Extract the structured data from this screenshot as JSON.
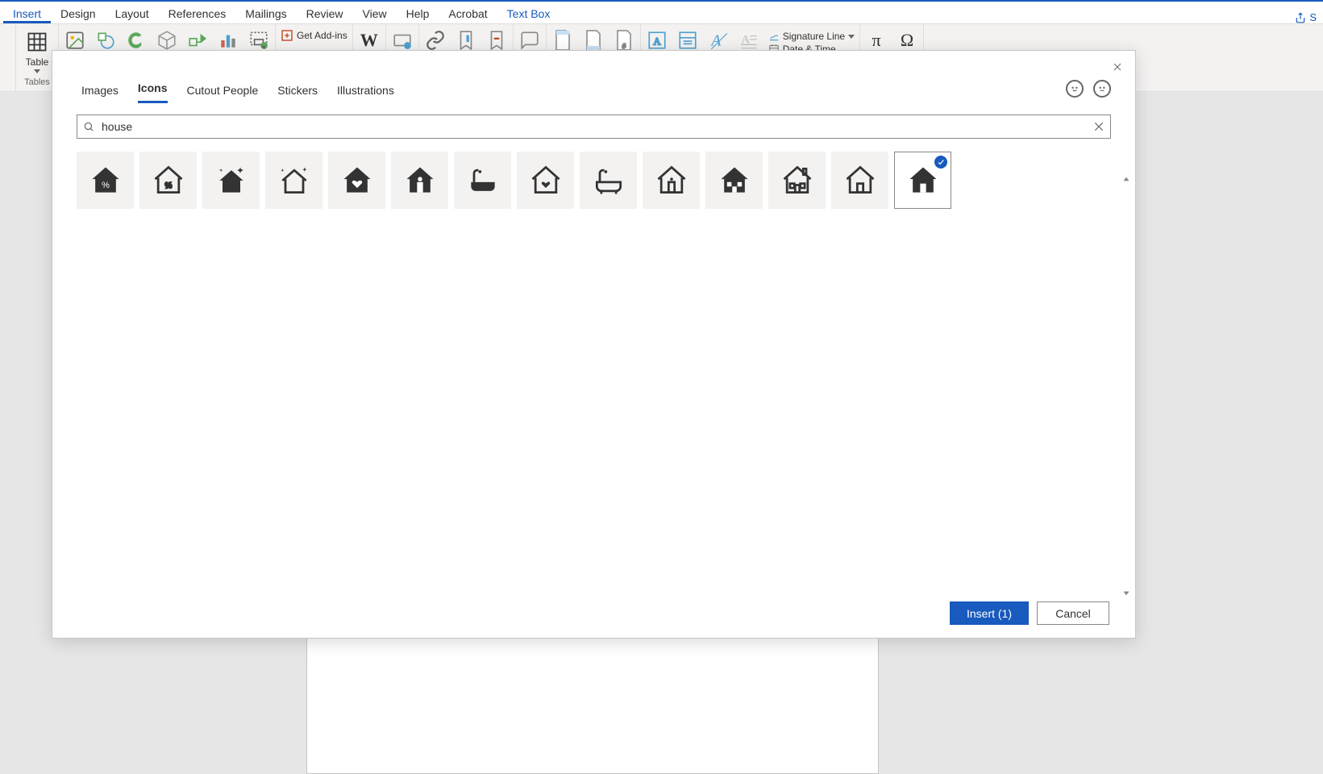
{
  "ribbon": {
    "tabs": [
      "Insert",
      "Design",
      "Layout",
      "References",
      "Mailings",
      "Review",
      "View",
      "Help",
      "Acrobat",
      "Text Box"
    ],
    "active_tab": "Insert",
    "context_tab_index": 9,
    "share_label": "S",
    "table_label": "Table",
    "tables_group": "Tables",
    "get_addins": "Get Add-ins",
    "sigline": "Signature Line",
    "datetime": "Date & Time"
  },
  "dialog": {
    "tabs": [
      "Images",
      "Icons",
      "Cutout People",
      "Stickers",
      "Illustrations"
    ],
    "active_tab": "Icons",
    "search_value": "house",
    "insert_label": "Insert (1)",
    "cancel_label": "Cancel",
    "selected_index": 13
  }
}
